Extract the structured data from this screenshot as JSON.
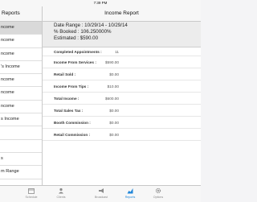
{
  "status_bar": {
    "time": "7:39 PM"
  },
  "sidebar": {
    "title": "Reports",
    "items": [
      {
        "label": "ncome",
        "selected": true
      },
      {
        "label": "ncome"
      },
      {
        "label": "ncome"
      },
      {
        "label": "'s Income"
      },
      {
        "label": "ncome"
      },
      {
        "label": "ncome"
      },
      {
        "label": "ncome"
      },
      {
        "label": "s Income"
      },
      {
        "label": ""
      },
      {
        "label": ""
      },
      {
        "label": "s"
      },
      {
        "label": "m Range"
      },
      {
        "label": ""
      }
    ]
  },
  "report": {
    "title": "Income Report",
    "date_range": "Date Range : 10/29/14 - 10/29/14",
    "booked": "% Booked : 106.250000%",
    "estimated": "Estimated : $590.00",
    "rows": [
      {
        "label": "Completed Appointments :",
        "value": "11"
      },
      {
        "label": "Income From Services :",
        "value": "$590.00"
      },
      {
        "label": "Retail Sold :",
        "value": "$0.00"
      },
      {
        "label": "Income From Tips :",
        "value": "$10.00"
      },
      {
        "label": "Total Income :",
        "value": "$600.00"
      },
      {
        "label": "Total Sales Tax :",
        "value": "$0.00"
      },
      {
        "label": "Booth Commission :",
        "value": "$0.00"
      },
      {
        "label": "Retail Commission :",
        "value": "$0.00"
      }
    ]
  },
  "tabbar": {
    "tabs": [
      {
        "label": "Schedule",
        "icon": "calendar-icon",
        "active": false
      },
      {
        "label": "Clients",
        "icon": "clients-icon",
        "active": false
      },
      {
        "label": "Broadcast",
        "icon": "megaphone-icon",
        "active": false
      },
      {
        "label": "Reports",
        "icon": "chart-icon",
        "active": true
      },
      {
        "label": "Options",
        "icon": "gear-icon",
        "active": false
      }
    ]
  }
}
